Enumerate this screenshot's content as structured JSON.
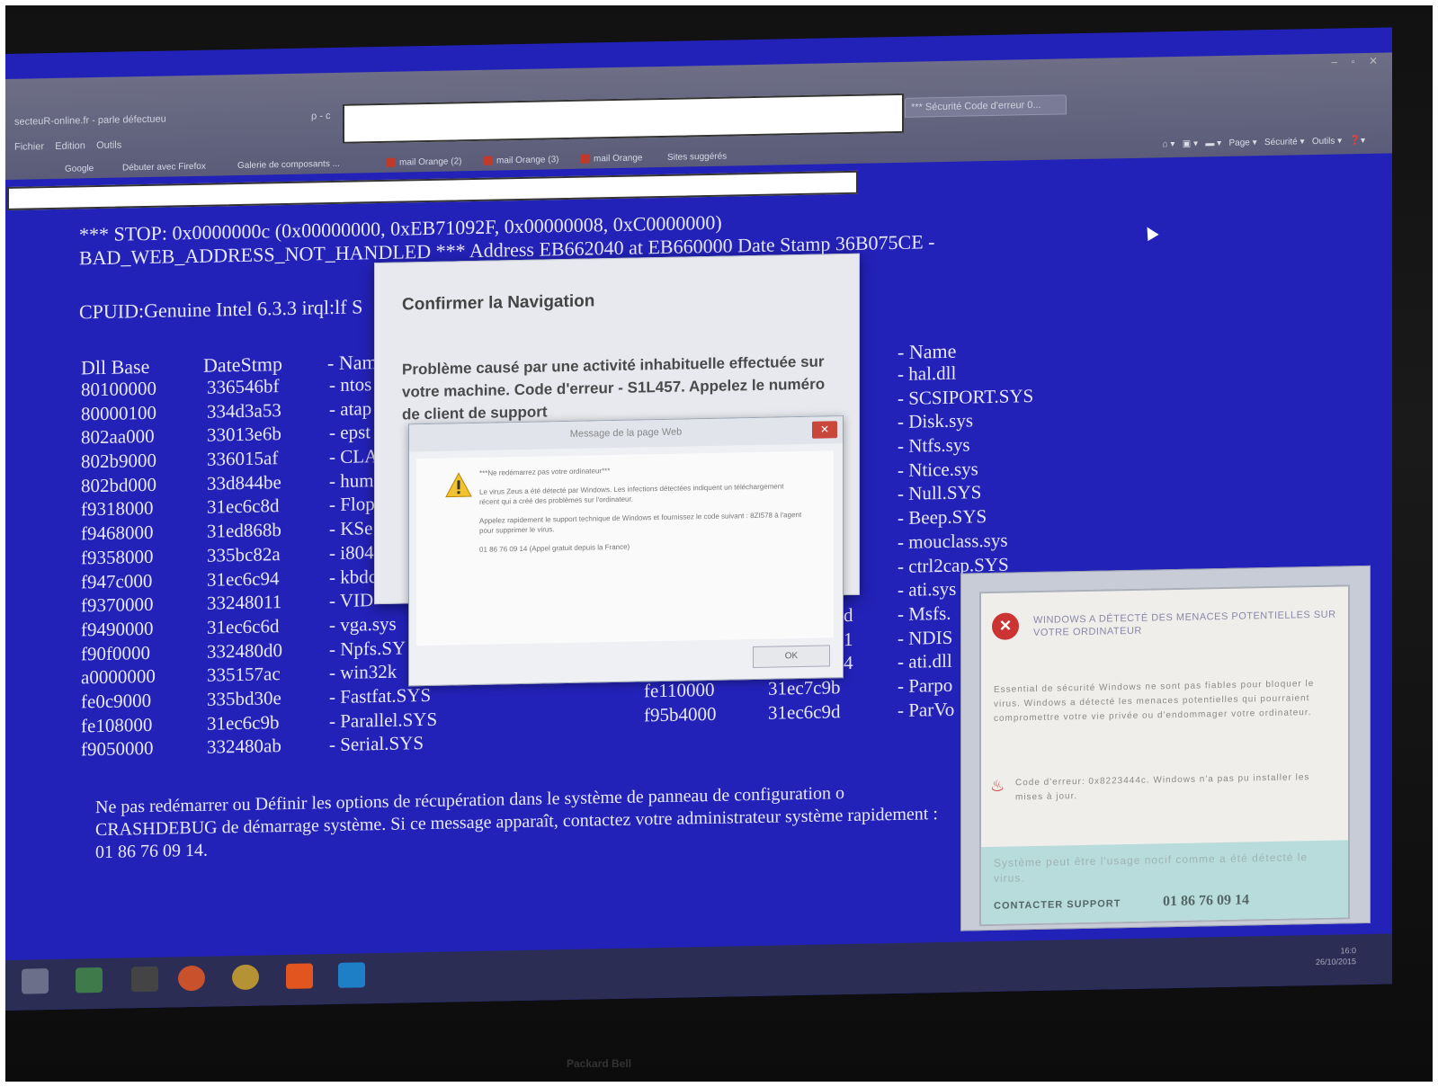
{
  "browser": {
    "address_fragment": "secteuR-online.fr - parle défectueu",
    "search_glyph": "ρ - c",
    "menu": [
      "Fichier",
      "Edition",
      "Outils"
    ],
    "active_tab": "*** Sécurité Code d'erreur 0...",
    "favorites": [
      "Google",
      "Débuter avec Firefox",
      "Galerie de composants ...",
      "mail Orange (2)",
      "mail Orange (3)",
      "mail Orange",
      "Sites suggérés"
    ],
    "toolbar_right": [
      "Page",
      "Sécurité",
      "Outils"
    ]
  },
  "bsod": {
    "stop_line": "*** STOP: 0x0000000c (0x00000000, 0xEB71092F, 0x00000008, 0xC0000000)",
    "bad_line": "BAD_WEB_ADDRESS_NOT_HANDLED *** Address EB662040 at EB660000 Date Stamp 36B075CE -",
    "cpuid": "CPUID:Genuine Intel 6.3.3 irql:lf S",
    "headers": {
      "dll_base": "Dll Base",
      "datestmp": "DateStmp",
      "name": "- Nam",
      "name2": "- Name"
    },
    "col_base": [
      "80100000",
      "80000100",
      "802aa000",
      "802b9000",
      "802bd000",
      "f9318000",
      "f9468000",
      "f9358000",
      "f947c000",
      "f9370000",
      "f9490000",
      "f90f0000",
      "a0000000",
      "fe0c9000",
      "fe108000",
      "f9050000"
    ],
    "col_stamp": [
      "336546bf",
      "334d3a53",
      "33013e6b",
      "336015af",
      "33d844be",
      "31ec6c8d",
      "31ed868b",
      "335bc82a",
      "31ec6c94",
      "33248011",
      "31ec6c6d",
      "332480d0",
      "335157ac",
      "335bd30e",
      "31ec6c9b",
      "332480ab"
    ],
    "col_name": [
      "- ntos",
      "- atap",
      "- epst",
      "- CLA",
      "- hum",
      "- Flop",
      "- KSe",
      "- i804",
      "- kbdc",
      "- VID",
      "- vga.sys",
      "- Npfs.SY",
      "- win32k",
      "- Fastfat.SYS",
      "- Parallel.SYS",
      "- Serial.SYS"
    ],
    "col_base2": [
      "fe110000",
      "f95b4000"
    ],
    "col_stamp2": [
      "31ec7c9b",
      "31ec6c9d"
    ],
    "col_name2": [
      "- hal.dll",
      "- SCSIPORT.SYS",
      "- Disk.sys",
      "- Ntfs.sys",
      "- Ntice.sys",
      "- Null.SYS",
      "- Beep.SYS",
      "- mouclass.sys",
      "- ctrl2cap.SYS",
      "- ati.sys",
      "- Msfs.",
      "- NDIS",
      "- ati.dll",
      "- Parpo",
      "- ParVo"
    ],
    "edge_letters": [
      "d",
      "1",
      "4"
    ],
    "footer": "Ne pas redémarrer ou Définir les options de récupération dans le système de panneau de configuration o CRASHDEBUG de démarrage système. Si ce message apparaît, contactez votre administrateur système rapidement : 01 86 76 09 14."
  },
  "confirm_dialog": {
    "title": "Confirmer la Navigation",
    "body": "Problème causé par une activité inhabituelle effectuée sur votre machine. Code d'erreur - S1L457. Appelez le numéro de client de support"
  },
  "alert": {
    "title": "Message de la page Web",
    "close": "✕",
    "line1": "***Ne redémarrez pas votre ordinateur***",
    "line2": "Le virus Zeus a été détecté par Windows. Les infections détectées indiquent un téléchargement récent qui a créé des problèmes sur l'ordinateur.",
    "line3": "Appelez rapidement le support technique de Windows et fournissez le code suivant : 8ZI578 à l'agent pour supprimer le virus.",
    "line4": "01 86 76 09 14 (Appel gratuit depuis la France)",
    "ok": "OK"
  },
  "threat": {
    "heading": "WINDOWS A DÉTECTÉ DES MENACES POTENTIELLES SUR VOTRE ORDINATEUR",
    "body": "Essential de sécurité Windows ne sont pas fiables pour bloquer le virus. Windows a détecté les menaces potentielles qui pourraient compromettre votre vie privée ou d'endommager votre ordinateur.",
    "error": "Code d'erreur: 0x8223444c. Windows n'a pas pu installer les mises à jour.",
    "footer": "Système peut être l'usage nocif comme a été détecté le virus.",
    "contact_label": "CONTACTER SUPPORT",
    "contact_phone": "01 86 76 09 14"
  },
  "taskbar": {
    "clock_time": "16:0",
    "clock_date": "26/10/2015"
  },
  "monitor_brand": "Packard Bell",
  "colors": {
    "bsod_blue": "#2322b8",
    "threat_red": "#cc3333",
    "footer_teal": "#b8dcdc"
  }
}
